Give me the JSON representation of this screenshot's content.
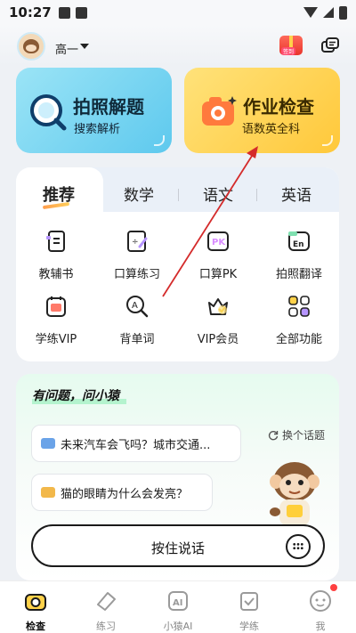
{
  "status_bar": {
    "time": "10:27"
  },
  "header": {
    "grade": "高一",
    "gift_badge": "签到"
  },
  "cards": {
    "photo_solve": {
      "title": "拍照解题",
      "subtitle": "搜索解析"
    },
    "homework_check": {
      "title": "作业检查",
      "subtitle": "语数英全科"
    }
  },
  "tabs": [
    {
      "label": "推荐",
      "active": true
    },
    {
      "label": "数学",
      "active": false
    },
    {
      "label": "语文",
      "active": false
    },
    {
      "label": "英语",
      "active": false
    }
  ],
  "tools": [
    {
      "label": "教辅书",
      "icon": "book-icon"
    },
    {
      "label": "口算练习",
      "icon": "calc-practice-icon"
    },
    {
      "label": "口算PK",
      "icon": "pk-icon"
    },
    {
      "label": "拍照翻译",
      "icon": "translate-icon"
    },
    {
      "label": "学练VIP",
      "icon": "calendar-icon"
    },
    {
      "label": "背单词",
      "icon": "vocab-search-icon"
    },
    {
      "label": "VIP会员",
      "icon": "vip-crown-icon"
    },
    {
      "label": "全部功能",
      "icon": "grid-icon"
    }
  ],
  "ask": {
    "title": "有问题，问小猿",
    "refresh_label": "换个话题",
    "q1": "未来汽车会飞吗？城市交通...",
    "q2": "猫的眼睛为什么会发亮？",
    "voice_label": "按住说话"
  },
  "nav": [
    {
      "label": "检查",
      "active": true
    },
    {
      "label": "练习",
      "active": false
    },
    {
      "label": "小猿AI",
      "active": false
    },
    {
      "label": "学练",
      "active": false
    },
    {
      "label": "我",
      "active": false
    }
  ],
  "colors": {
    "accent_blue": "#5ec9ee",
    "accent_yellow": "#ffc83a",
    "annotation_red": "#d42b2b",
    "notification_red": "#ff4040"
  }
}
